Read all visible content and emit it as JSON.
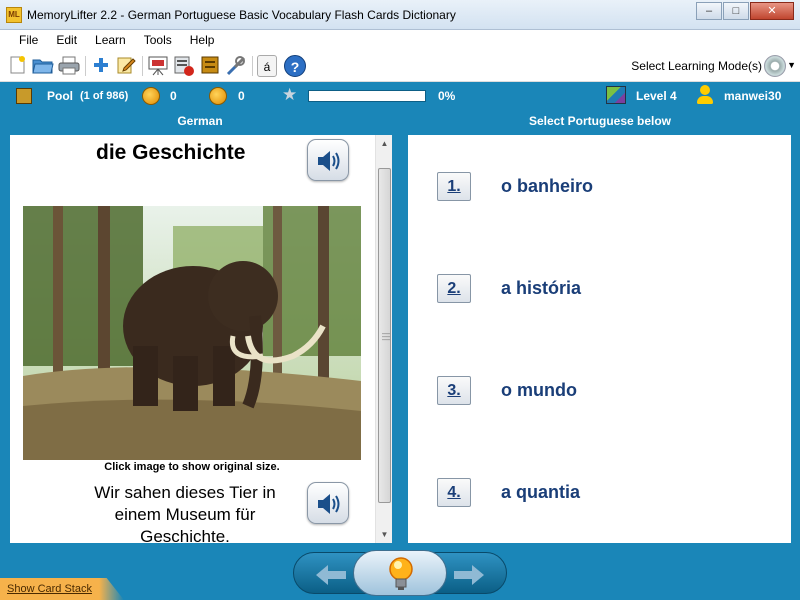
{
  "window": {
    "title": "MemoryLifter 2.2 - German Portuguese Basic Vocabulary Flash Cards Dictionary",
    "app_icon_text": "ML"
  },
  "menu": [
    "File",
    "Edit",
    "Learn",
    "Tools",
    "Help"
  ],
  "toolbar": {
    "icons": [
      "new-icon",
      "open-icon",
      "print-icon",
      "add-icon",
      "edit-icon",
      "slideshow-icon",
      "delete-card-icon",
      "card-icon",
      "settings-icon",
      "special-char-icon",
      "help-icon"
    ],
    "special_char_label": "á",
    "help_label": "?",
    "learning_mode_label": "Select Learning Mode(s)"
  },
  "status": {
    "pool_label": "Pool",
    "pool_count": "(1 of 986)",
    "correct_count": "0",
    "wrong_count": "0",
    "progress_percent": "0%",
    "progress_value": 0,
    "level": "Level 4",
    "user": "manwei30"
  },
  "left": {
    "header": "German",
    "word": "die Geschichte",
    "image_caption": "Click image to show original size.",
    "sentence": "Wir sahen dieses Tier in einem Museum für Geschichte."
  },
  "right": {
    "header": "Select Portuguese below",
    "answers": [
      {
        "number": "1.",
        "text": "o banheiro"
      },
      {
        "number": "2.",
        "text": "a história"
      },
      {
        "number": "3.",
        "text": "o mundo"
      },
      {
        "number": "4.",
        "text": "a quantia"
      }
    ]
  },
  "footer": {
    "card_stack_link": "Show Card Stack"
  },
  "colors": {
    "frame_blue": "#1a86b8",
    "answer_text": "#1a3e78",
    "progress_green": "#4aa02c",
    "card_stack_orange": "#f6b24b"
  }
}
